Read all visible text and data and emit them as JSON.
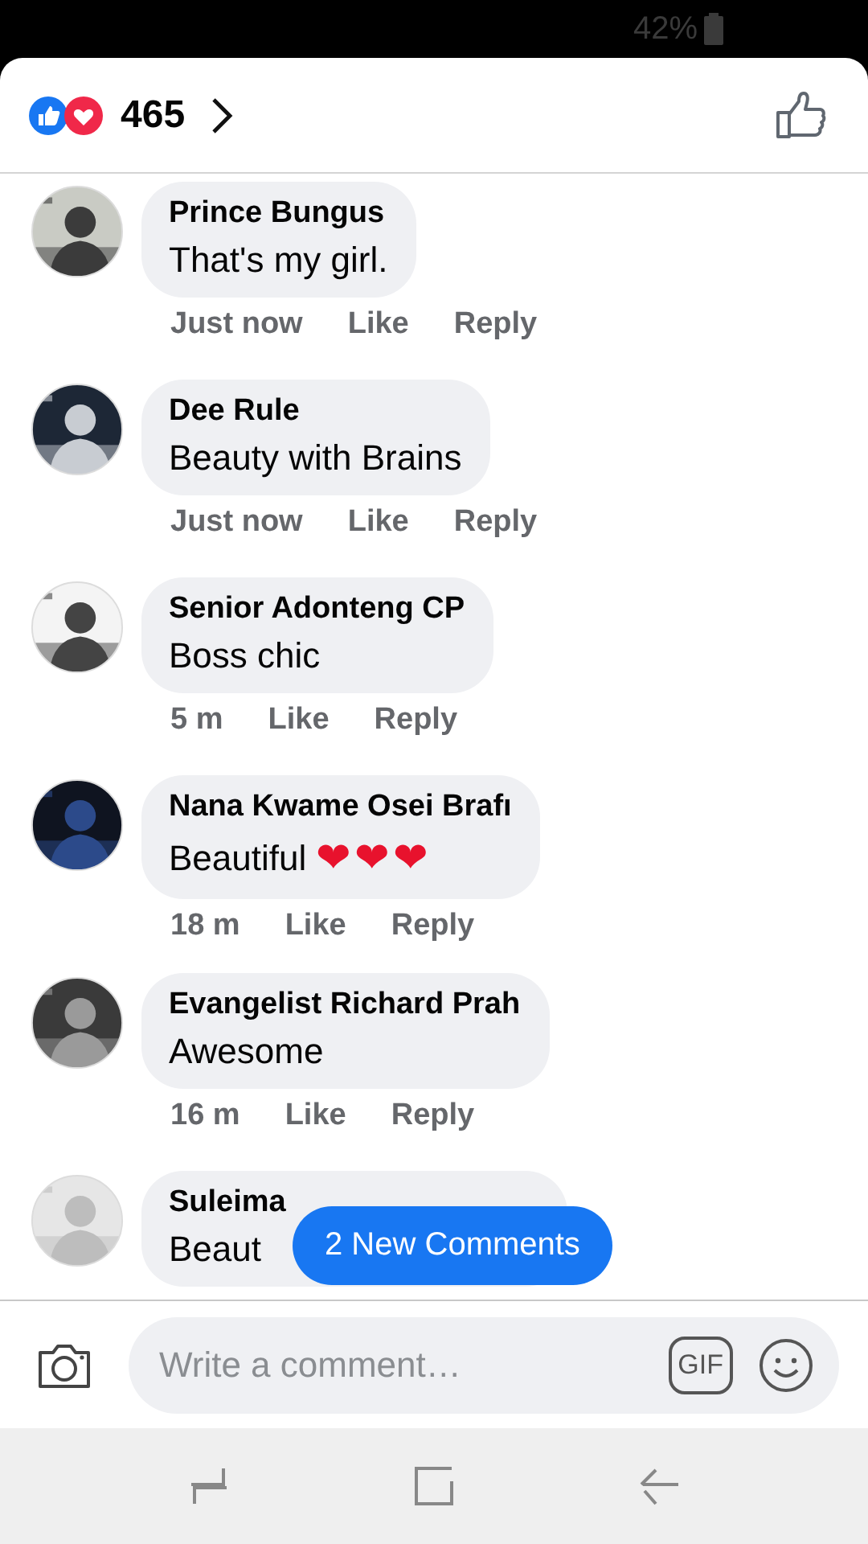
{
  "status_bar": {
    "battery": "42%"
  },
  "header": {
    "reaction_count": "465"
  },
  "comments": [
    {
      "name": "Prince Bungus",
      "text": "That's my girl.",
      "time": "Just now",
      "like": "Like",
      "reply": "Reply"
    },
    {
      "name": "Dee Rule",
      "text": "Beauty with Brains",
      "time": "Just now",
      "like": "Like",
      "reply": "Reply"
    },
    {
      "name": "Senior Adonteng CP",
      "text": "Boss chic",
      "time": "5 m",
      "like": "Like",
      "reply": "Reply"
    },
    {
      "name": "Nana Kwame Osei Brafı",
      "text": "Beautiful",
      "emoji": "❤❤❤",
      "time": "18 m",
      "like": "Like",
      "reply": "Reply"
    },
    {
      "name": "Evangelist Richard Prah",
      "text": "Awesome",
      "time": "16 m",
      "like": "Like",
      "reply": "Reply"
    },
    {
      "name": "Suleima",
      "text": "Beaut"
    }
  ],
  "new_comments_button": "2 New Comments",
  "composer": {
    "placeholder": "Write a comment…",
    "gif": "GIF"
  }
}
